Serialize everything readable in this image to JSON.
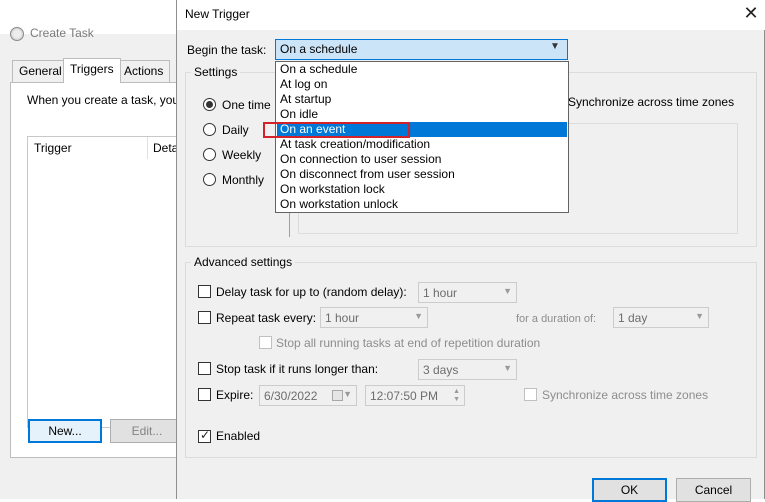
{
  "background_window": {
    "title": "Create Task",
    "tabs": [
      "General",
      "Triggers",
      "Actions"
    ],
    "active_tab": "Triggers",
    "description": "When you create a task, you",
    "table_columns": [
      "Trigger",
      "Deta"
    ],
    "new_button": "New...",
    "edit_button": "Edit..."
  },
  "dialog": {
    "title": "New Trigger",
    "close_glyph": "✕",
    "begin_label": "Begin the task:",
    "begin_value": "On a schedule",
    "dropdown_options": [
      "On a schedule",
      "At log on",
      "At startup",
      "On idle",
      "On an event",
      "At task creation/modification",
      "On connection to user session",
      "On disconnect from user session",
      "On workstation lock",
      "On workstation unlock"
    ],
    "selected_option": "On an event",
    "settings_legend": "Settings",
    "schedule_options": [
      "One time",
      "Daily",
      "Weekly",
      "Monthly"
    ],
    "schedule_selected": "One time",
    "sync_label": "Synchronize across time zones",
    "advanced_legend": "Advanced settings",
    "delay_label": "Delay task for up to (random delay):",
    "delay_value": "1 hour",
    "repeat_label": "Repeat task every:",
    "repeat_value": "1 hour",
    "duration_label": "for a duration of:",
    "duration_value": "1 day",
    "stop_running_label": "Stop all running tasks at end of repetition duration",
    "stop_longer_label": "Stop task if it runs longer than:",
    "stop_longer_value": "3 days",
    "expire_label": "Expire:",
    "expire_date": "6/30/2022",
    "expire_time": "12:07:50 PM",
    "expire_sync_label": "Synchronize across time zones",
    "enabled_label": "Enabled",
    "enabled_checked": true,
    "ok_button": "OK",
    "cancel_button": "Cancel"
  },
  "colors": {
    "selection": "#0078d7",
    "highlight_box": "#d2232a",
    "dialog_bg": "#f0f0f0"
  }
}
